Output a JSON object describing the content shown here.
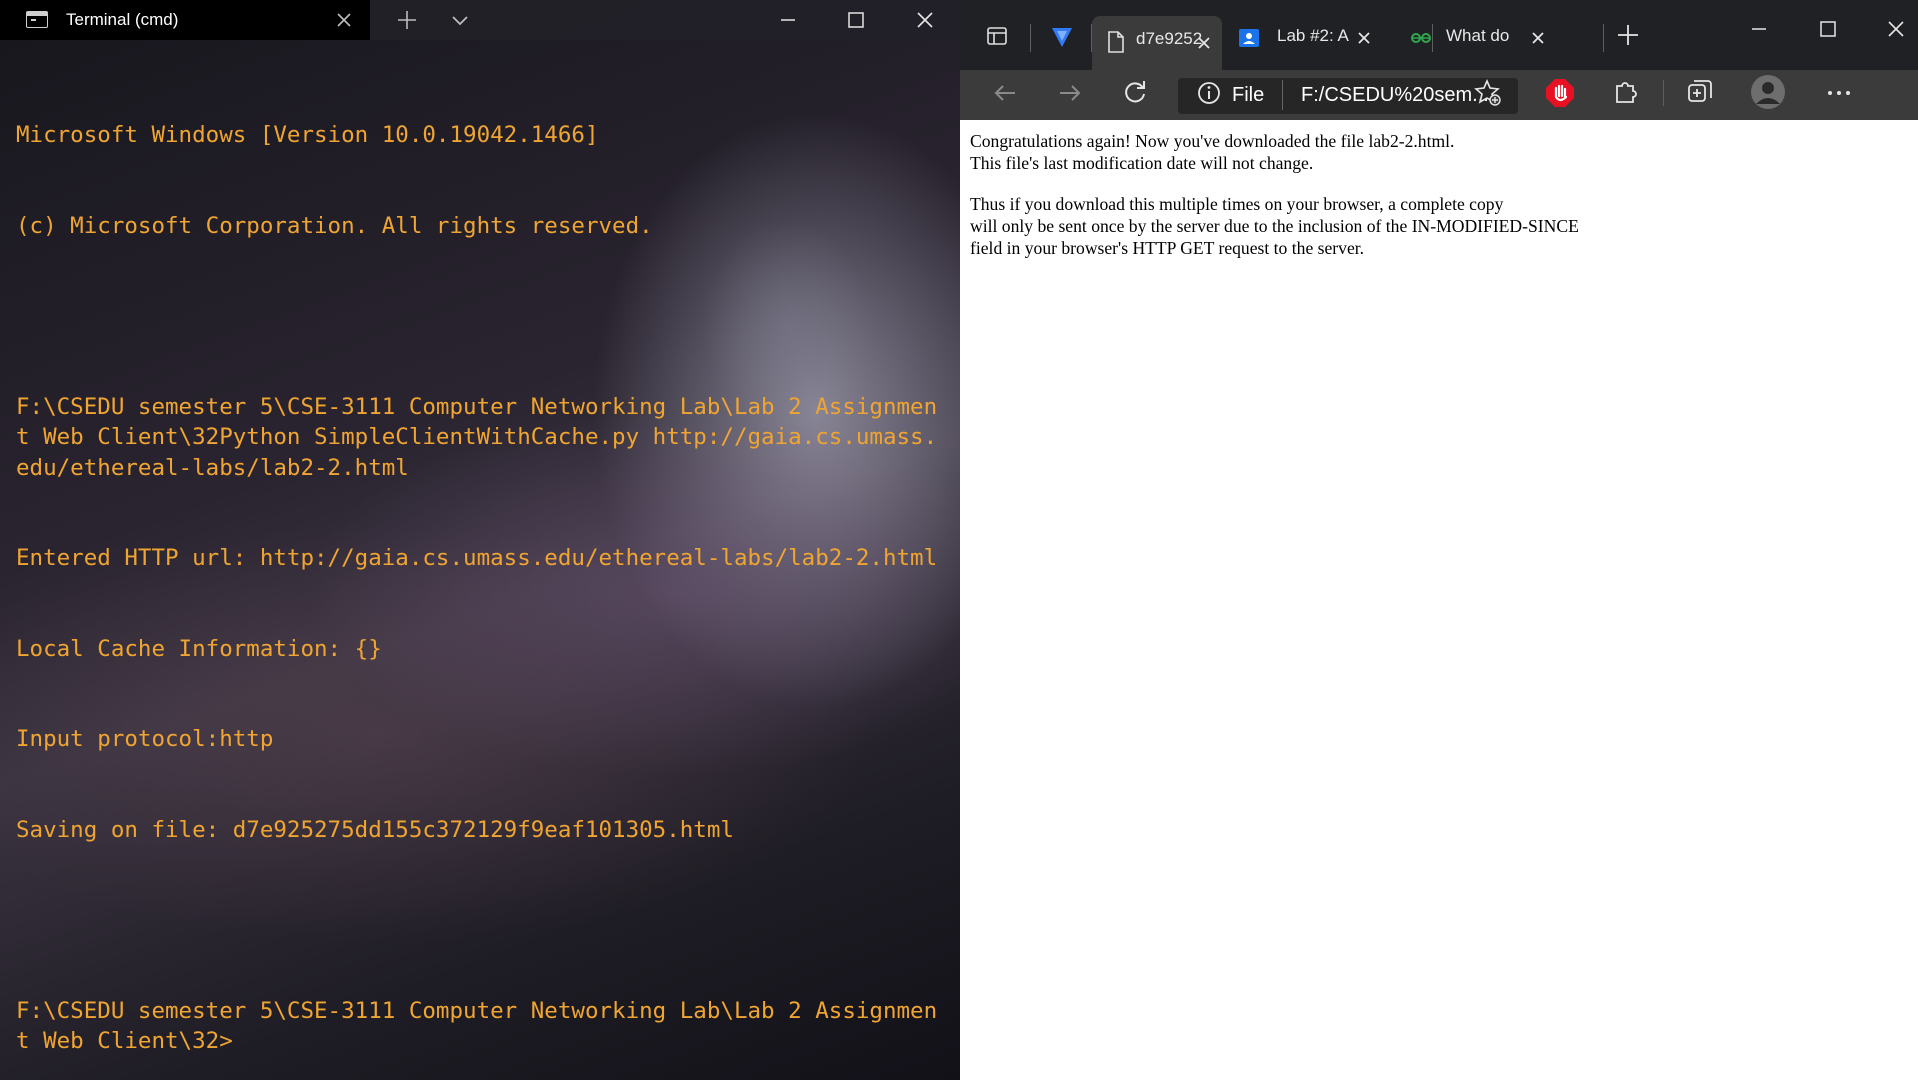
{
  "terminal": {
    "tab_title": "Terminal (cmd)",
    "lines": [
      "Microsoft Windows [Version 10.0.19042.1466]",
      "(c) Microsoft Corporation. All rights reserved.",
      "",
      "F:\\CSEDU semester 5\\CSE-3111 Computer Networking Lab\\Lab 2 Assignment Web Client\\32Python SimpleClientWithCache.py http://gaia.cs.umass.edu/ethereal-labs/lab2-2.html",
      "Entered HTTP url: http://gaia.cs.umass.edu/ethereal-labs/lab2-2.html",
      "Local Cache Information: {}",
      "Input protocol:http",
      "Saving on file: d7e925275dd155c372129f9eaf101305.html",
      "",
      "F:\\CSEDU semester 5\\CSE-3111 Computer Networking Lab\\Lab 2 Assignment Web Client\\32>"
    ],
    "text_color": "#f0a532"
  },
  "browser": {
    "tabs": [
      {
        "label": "d7e9252",
        "active": true,
        "icon": "document-icon"
      },
      {
        "label": "Lab #2: A",
        "active": false,
        "icon": "classroom-icon"
      },
      {
        "label": "What do",
        "active": false,
        "icon": "link-icon"
      }
    ],
    "address": {
      "scheme_label": "File",
      "url": "F:/CSEDU%20sem..."
    },
    "page": {
      "paragraphs": [
        [
          "Congratulations again! Now you've downloaded the file lab2-2.html.",
          "This file's last modification date will not change."
        ],
        [
          "Thus if you download this multiple times on your browser, a complete copy",
          "will only be sent once by the server due to the inclusion of the IN-MODIFIED-SINCE",
          "field in your browser's HTTP GET request to the server."
        ]
      ]
    },
    "colors": {
      "tabstrip": "#202124",
      "toolbar": "#3b3b3b",
      "adblock_red": "#e81123",
      "vpn_blue": "#2f7bf5"
    }
  }
}
